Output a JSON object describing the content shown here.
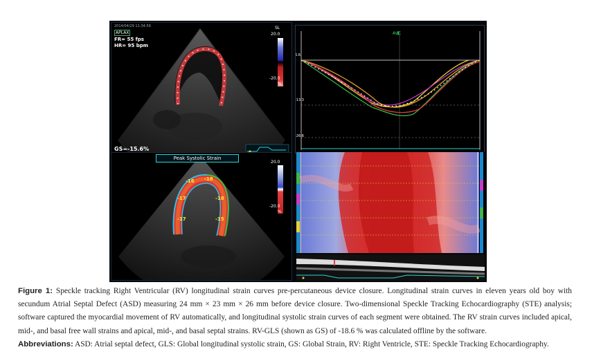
{
  "figure": {
    "top_left": {
      "timestamp": "2014/04/29 11:34:59",
      "view": "APLAX",
      "frame_rate": "FR= 55 fps",
      "heart_rate": "HR= 95 bpm",
      "scale_label": "SL",
      "scale_max": "20.0",
      "scale_min": "-20.0",
      "scale_unit": "%",
      "gs_value": "GS=-15.6%"
    },
    "top_right": {
      "avc_label": "AVC",
      "tick_top": "6.6",
      "tick_mid": "-13.3",
      "tick_bottom": "-26.6"
    },
    "bottom_left": {
      "title": "Peak Systolic Strain",
      "scale_max": "20.0",
      "scale_min": "-20.0",
      "scale_unit": "%",
      "segment_values": [
        "-16",
        "-18",
        "-17",
        "-18",
        "-17",
        "-15"
      ]
    },
    "colors": {
      "trace_yellow": "#e6d23a",
      "trace_green": "#3fb54a",
      "trace_magenta": "#c83cc8",
      "trace_red": "#e03c3c",
      "trace_orange": "#e0a030",
      "trace_dotted": "#ffffff",
      "axis_cyan": "#2dd4d4"
    }
  },
  "caption": {
    "label": "Figure 1:",
    "text": "Speckle tracking Right Ventricular (RV) longitudinal strain curves pre-percutaneous device closure. Longitudinal strain curves in eleven years old boy with secundum Atrial Septal Defect (ASD) measuring 24 mm × 23 mm × 26 mm before device closure. Two-dimensional Speckle Tracking Echocardiography (STE) analysis; software captured the myocardial movement of RV automatically, and longitudinal systolic strain curves of each segment were obtained. The RV strain curves included apical, mid-, and basal free wall strains and apical, mid-, and basal septal strains. RV-GLS (shown as GS) of -18.6 % was calculated offline by the software.",
    "abbrev_label": "Abbreviations:",
    "abbrev_text": "ASD: Atrial septal defect, GLS: Global longitudinal systolic strain, GS: Global Strain, RV: Right Ventricle, STE: Speckle Tracking Echocardiography."
  }
}
